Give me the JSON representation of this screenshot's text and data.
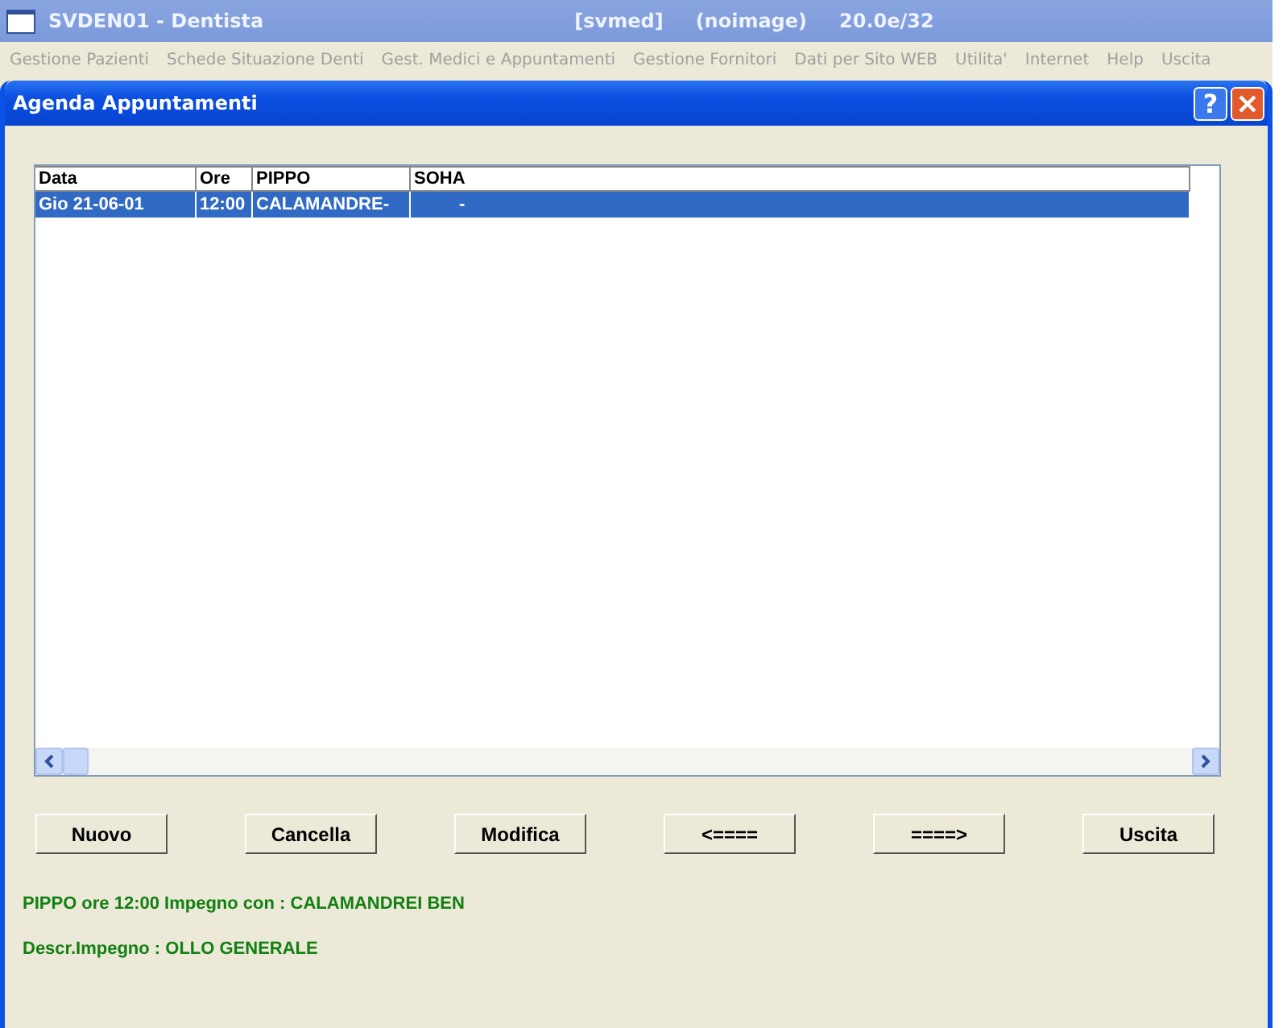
{
  "app_window": {
    "title": "SVDEN01 - Dentista",
    "info": [
      "[svmed]",
      "(noimage)",
      "20.0e/32"
    ]
  },
  "menu": [
    "Gestione Pazienti",
    "Schede Situazione Denti",
    "Gest. Medici e Appuntamenti",
    "Gestione Fornitori",
    "Dati per Sito WEB",
    "Utilita'",
    "Internet",
    "Help",
    "Uscita"
  ],
  "dialog": {
    "title": "Agenda Appuntamenti",
    "help_button": "?"
  },
  "table": {
    "columns": [
      "Data",
      "Ore",
      "PIPPO",
      "SOHA"
    ],
    "rows": [
      {
        "cells": [
          "Gio 21-06-01",
          "12:00",
          "CALAMANDRE-",
          "-"
        ],
        "selected": true
      }
    ]
  },
  "buttons": [
    "Nuovo",
    "Cancella",
    "Modifica",
    "<====",
    "====>",
    "Uscita"
  ],
  "details": [
    "PIPPO ore 12:00 Impegno con : CALAMANDREI BEN",
    "Descr.Impegno : OLLO GENERALE"
  ]
}
